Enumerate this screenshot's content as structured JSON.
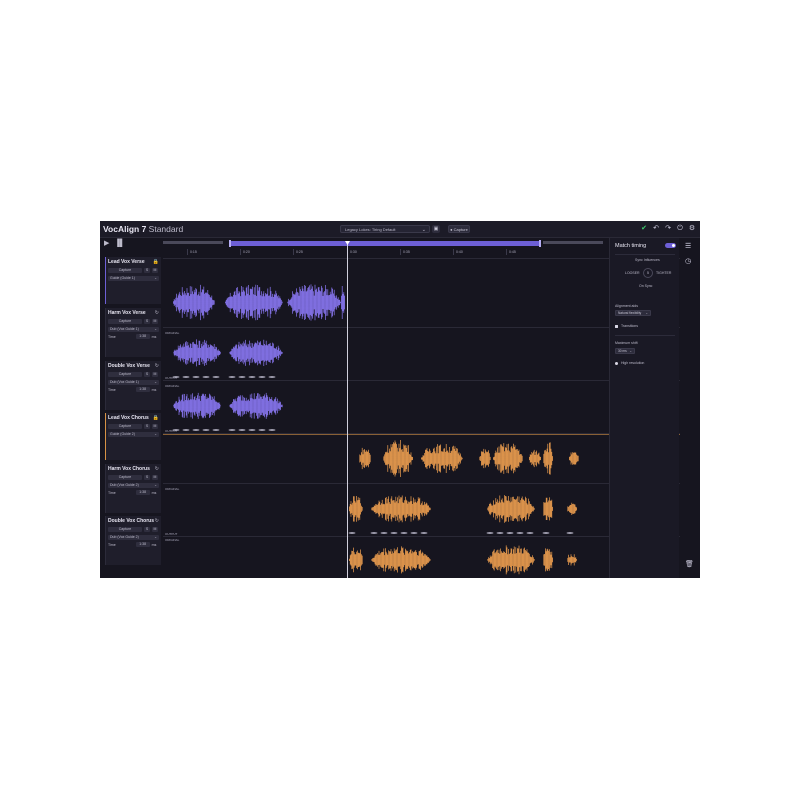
{
  "app": {
    "brand": "VocAlign 7",
    "edition": "Standard"
  },
  "toolbar": {
    "preset_value": "Legacy Lokes: Tiring Default",
    "capture_label": "● Capture",
    "save_icon": "save-icon",
    "icons": [
      "check-icon",
      "undo-icon",
      "redo-icon",
      "power-icon",
      "settings-icon"
    ]
  },
  "transport": {
    "play_icon": "play-icon",
    "meter_icon": "meter-icon"
  },
  "ruler": {
    "ticks": [
      "0:15",
      "0:20",
      "0:25",
      "0:30",
      "0:35",
      "0:40",
      "0:45"
    ]
  },
  "tracks": [
    {
      "name": "Lead Vox Verse",
      "role": "guide",
      "capture": "Capture",
      "assignment": "Guide (Guide 1)",
      "color": "#8b78f5",
      "has_time": false
    },
    {
      "name": "Harm Vox Verse",
      "role": "dub",
      "capture": "Capture",
      "assignment": "Dub (Vox Guide 1)",
      "color": "#8b78f5",
      "has_time": true,
      "time_label": "Time",
      "time_value": "1:38",
      "time_unit": "ms"
    },
    {
      "name": "Double Vox Verse",
      "role": "dub",
      "capture": "Capture",
      "assignment": "Dub (Vox Guide 1)",
      "color": "#8b78f5",
      "has_time": true,
      "time_label": "Time",
      "time_value": "1:38",
      "time_unit": "ms"
    },
    {
      "name": "Lead Vox Chorus",
      "role": "guide",
      "capture": "Capture",
      "assignment": "Guide (Guide 2)",
      "color": "#f0a050",
      "has_time": false
    },
    {
      "name": "Harm Vox Chorus",
      "role": "dub",
      "capture": "Capture",
      "assignment": "Dub (Vox Guide 2)",
      "color": "#f0a050",
      "has_time": true,
      "time_label": "Time",
      "time_value": "1:38",
      "time_unit": "ms"
    },
    {
      "name": "Double Vox Chorus",
      "role": "dub",
      "capture": "Capture",
      "assignment": "Dub (Vox Guide 2)",
      "color": "#f0a050",
      "has_time": true,
      "time_label": "Time",
      "time_value": "1:38",
      "time_unit": "ms"
    }
  ],
  "lane_labels": {
    "original": "ORIGINAL",
    "output": "OUTPUT"
  },
  "right_panel": {
    "title": "Match timing",
    "enabled": true,
    "sync_header": "Sync Influences",
    "looser": "LOOSER",
    "tighter": "TIGHTER",
    "sync_value": "5",
    "sync_caption": "On Sync",
    "alignment_label": "Alignment aids",
    "alignment_value": "Natural flexibility",
    "transitions_label": "Transitions",
    "max_shift_label": "Maximum shift",
    "max_shift_value": "30 ms",
    "high_resolution_label": "High resolution"
  },
  "side_rail": {
    "icons": [
      "list-icon",
      "clock-icon",
      "trash-icon"
    ]
  },
  "colors": {
    "purple": "#8b78f5",
    "orange": "#f0a050",
    "accent": "#6d5fd6",
    "background": "#16151f"
  }
}
